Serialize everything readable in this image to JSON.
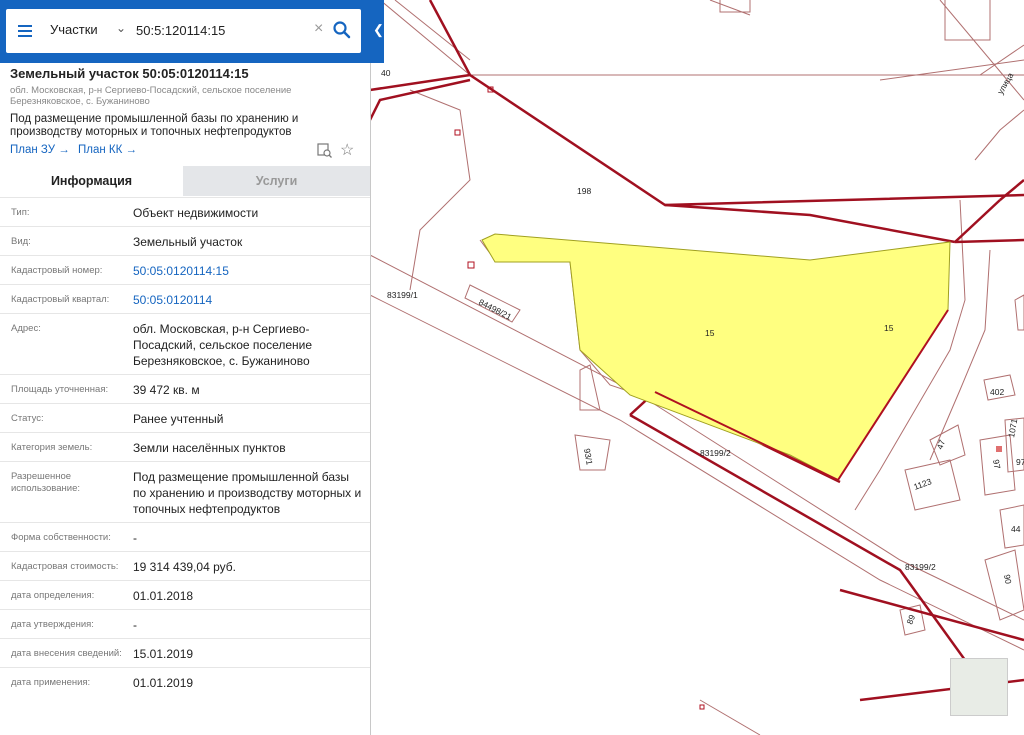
{
  "search": {
    "layer": "Участки",
    "value": "50:5:120114:15"
  },
  "object": {
    "title": "Земельный участок 50:05:0120114:15",
    "address_short": "обл. Московская, р-н Сергиево-Посадский, сельское поселение Березняковское, с. Бужаниново",
    "purpose": "Под размещение промышленной базы по хранению и производству моторных и топочных нефтепродуктов",
    "plan_zu": "План ЗУ →",
    "plan_kk": "План КК →"
  },
  "tabs": {
    "info": "Информация",
    "services": "Услуги"
  },
  "rows": [
    {
      "label": "Тип:",
      "value": "Объект недвижимости"
    },
    {
      "label": "Вид:",
      "value": "Земельный участок"
    },
    {
      "label": "Кадастровый номер:",
      "value": "50:05:0120114:15"
    },
    {
      "label": "Кадастровый квартал:",
      "value": "50:05:0120114"
    },
    {
      "label": "Адрес:",
      "value": "обл. Московская, р-н Сергиево-Посадский, сельское поселение Березняковское, с. Бужаниново"
    },
    {
      "label": "Площадь уточненная:",
      "value": "39 472 кв. м"
    },
    {
      "label": "Статус:",
      "value": "Ранее учтенный"
    },
    {
      "label": "Категория земель:",
      "value": "Земли населённых пунктов"
    },
    {
      "label": "Разрешенное использование:",
      "value": "Под размещение промышленной базы по хранению и производству моторных и топочных нефтепродуктов"
    },
    {
      "label": "Форма собственности:",
      "value": "-"
    },
    {
      "label": "Кадастровая стоимость:",
      "value": "19 314 439,04 руб."
    },
    {
      "label": "дата определения:",
      "value": "01.01.2018"
    },
    {
      "label": "дата утверждения:",
      "value": "-"
    },
    {
      "label": "дата внесения сведений:",
      "value": "15.01.2019"
    },
    {
      "label": "дата применения:",
      "value": "01.01.2019"
    }
  ],
  "map_labels": {
    "l40": "40",
    "l198": "198",
    "l83199_1": "83199/1",
    "l84498_21": "84498/21",
    "l15a": "15",
    "l15b": "15",
    "l83199_2a": "83199/2",
    "l83199_2b": "83199/2",
    "l93_1": "93/1",
    "l402": "402",
    "l47": "47",
    "l1123": "1123",
    "l1071": "1071",
    "l97a": "97",
    "l97b": "97",
    "l44": "44",
    "l90": "90",
    "l89": "89",
    "l_street": "улица"
  },
  "colors": {
    "accent": "#1565c0",
    "parcel_fill": "#ffff80",
    "parcel_border": "#a01020"
  }
}
